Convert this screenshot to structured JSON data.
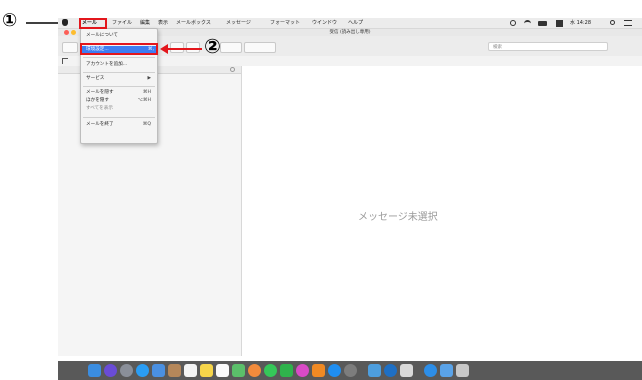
{
  "annotations": {
    "step1": "①",
    "step2": "②"
  },
  "menubar": {
    "apple": "",
    "items": [
      "メール",
      "ファイル",
      "編集",
      "表示",
      "メールボックス",
      "メッセージ",
      "フォーマット",
      "ウインドウ",
      "ヘルプ"
    ],
    "clock": "水 14:28"
  },
  "window": {
    "title": "受信 (読み出し専用)",
    "search_placeholder": "検索"
  },
  "app_menu": {
    "about": "メールについて",
    "preferences": "環境設定...",
    "preferences_shortcut": "⌘,",
    "add_account": "アカウントを追加...",
    "services": "サービス",
    "services_arrow": "▶",
    "hide_mail": "メールを隠す",
    "hide_mail_shortcut": "⌘H",
    "hide_others": "ほかを隠す",
    "hide_others_shortcut": "⌥⌘H",
    "show_all": "すべてを表示",
    "quit": "メールを終了",
    "quit_shortcut": "⌘Q"
  },
  "content": {
    "empty_message": "メッセージ未選択"
  },
  "colors": {
    "highlight": "#e3161c",
    "selection": "#3d7cf2"
  }
}
